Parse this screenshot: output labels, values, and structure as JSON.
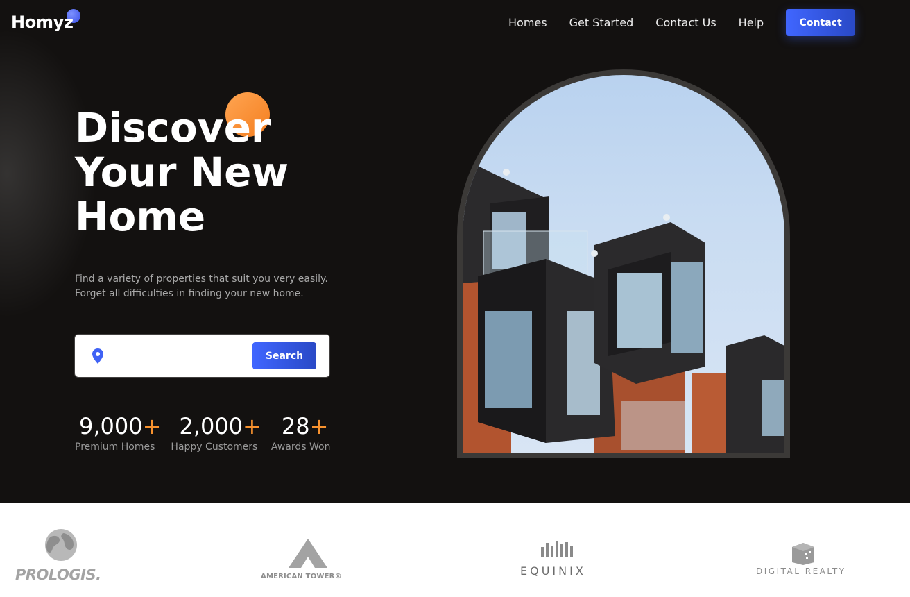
{
  "brand": {
    "name": "Homyz",
    "accent_blue": "#4066ff",
    "accent_orange": "#f8922e"
  },
  "nav": {
    "links": [
      "Homes",
      "Get Started",
      "Contact Us",
      "Help"
    ],
    "contact_label": "Contact"
  },
  "hero": {
    "headline_lines": [
      "Discover",
      "Your New",
      "Home"
    ],
    "subtext_lines": [
      "Find a variety of properties that suit you very easily.",
      "Forget all difficulties in finding your new home."
    ],
    "search": {
      "value": "",
      "placeholder": "",
      "button_label": "Search",
      "icon": "location-pin-icon"
    },
    "stats": [
      {
        "value": "9,000",
        "suffix": "+",
        "label": "Premium Homes"
      },
      {
        "value": "2,000",
        "suffix": "+",
        "label": "Happy Customers"
      },
      {
        "value": "28",
        "suffix": "+",
        "label": "Awards Won"
      }
    ],
    "image_alt": "Modern apartment building with dark cladding and balconies"
  },
  "partners": [
    {
      "name": "PROLOGIS",
      "suffix": "."
    },
    {
      "name": "AMERICAN TOWER",
      "suffix": "®"
    },
    {
      "name": "EQUINIX",
      "suffix": ""
    },
    {
      "name": "DIGITAL REALTY",
      "suffix": ""
    }
  ]
}
